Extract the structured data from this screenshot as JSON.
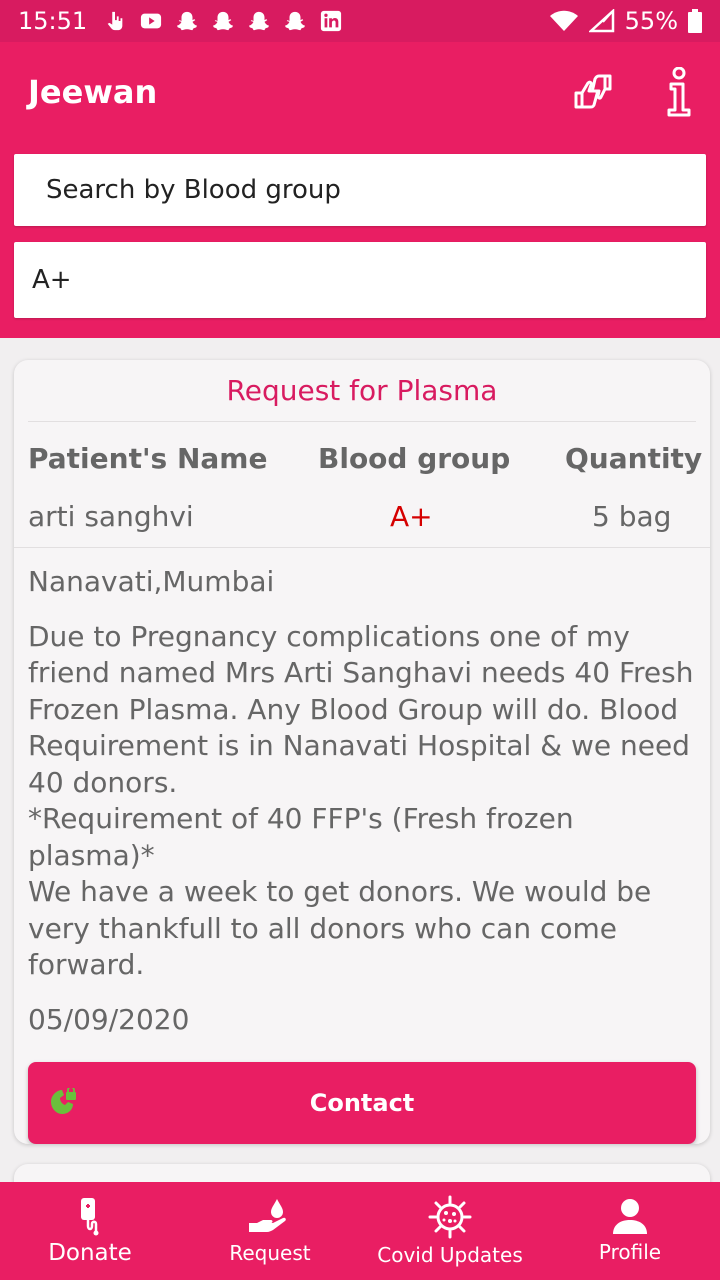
{
  "status_bar": {
    "time": "15:51",
    "battery": "55%"
  },
  "app_bar": {
    "title": "Jeewan",
    "icons": [
      "thumbs-up-down-icon",
      "info-icon"
    ]
  },
  "search": {
    "label": "Search by Blood group",
    "value": "A+"
  },
  "request": {
    "title": "Request for Plasma",
    "columns": [
      "Patient's Name",
      "Blood group",
      "Quantity"
    ],
    "patient_name": "arti sanghvi",
    "blood_group": "A+",
    "quantity": "5 bag",
    "location": "Nanavati,Mumbai",
    "description": "Due to Pregnancy complications one of my friend named Mrs Arti Sanghavi needs 40 Fresh Frozen Plasma. Any Blood Group will do. Blood Requirement is in Nanavati Hospital & we need 40 donors.\n*Requirement of 40 FFP's (Fresh frozen plasma)*\nWe have a week to get donors. We would be very thankfull to all donors who can come forward.",
    "date": "05/09/2020",
    "contact_label": "Contact"
  },
  "bottom_nav": [
    {
      "label": "Donate",
      "icon": "blood-bag-icon",
      "active": true
    },
    {
      "label": "Request",
      "icon": "hand-drop-icon",
      "active": false
    },
    {
      "label": "Covid Updates",
      "icon": "virus-icon",
      "active": false
    },
    {
      "label": "Profile",
      "icon": "person-icon",
      "active": false
    }
  ],
  "colors": {
    "primary": "#e91e63",
    "status_bar": "#d81b60",
    "accent_text": "#d81b60",
    "blood_group_text": "#d50000"
  }
}
